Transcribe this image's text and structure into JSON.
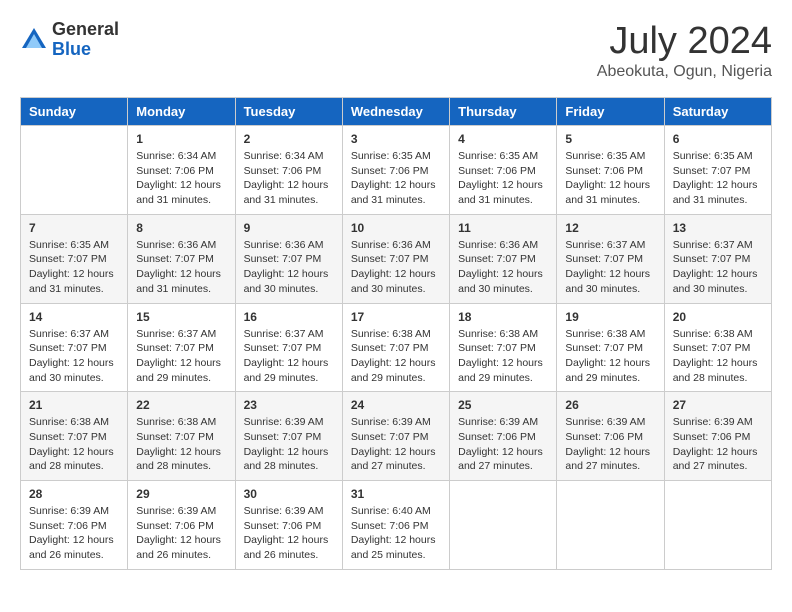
{
  "header": {
    "logo": {
      "general": "General",
      "blue": "Blue"
    },
    "title": "July 2024",
    "location": "Abeokuta, Ogun, Nigeria"
  },
  "days_header": [
    "Sunday",
    "Monday",
    "Tuesday",
    "Wednesday",
    "Thursday",
    "Friday",
    "Saturday"
  ],
  "weeks": [
    [
      {
        "num": "",
        "info": ""
      },
      {
        "num": "1",
        "info": "Sunrise: 6:34 AM\nSunset: 7:06 PM\nDaylight: 12 hours\nand 31 minutes."
      },
      {
        "num": "2",
        "info": "Sunrise: 6:34 AM\nSunset: 7:06 PM\nDaylight: 12 hours\nand 31 minutes."
      },
      {
        "num": "3",
        "info": "Sunrise: 6:35 AM\nSunset: 7:06 PM\nDaylight: 12 hours\nand 31 minutes."
      },
      {
        "num": "4",
        "info": "Sunrise: 6:35 AM\nSunset: 7:06 PM\nDaylight: 12 hours\nand 31 minutes."
      },
      {
        "num": "5",
        "info": "Sunrise: 6:35 AM\nSunset: 7:06 PM\nDaylight: 12 hours\nand 31 minutes."
      },
      {
        "num": "6",
        "info": "Sunrise: 6:35 AM\nSunset: 7:07 PM\nDaylight: 12 hours\nand 31 minutes."
      }
    ],
    [
      {
        "num": "7",
        "info": "Sunrise: 6:35 AM\nSunset: 7:07 PM\nDaylight: 12 hours\nand 31 minutes."
      },
      {
        "num": "8",
        "info": "Sunrise: 6:36 AM\nSunset: 7:07 PM\nDaylight: 12 hours\nand 31 minutes."
      },
      {
        "num": "9",
        "info": "Sunrise: 6:36 AM\nSunset: 7:07 PM\nDaylight: 12 hours\nand 30 minutes."
      },
      {
        "num": "10",
        "info": "Sunrise: 6:36 AM\nSunset: 7:07 PM\nDaylight: 12 hours\nand 30 minutes."
      },
      {
        "num": "11",
        "info": "Sunrise: 6:36 AM\nSunset: 7:07 PM\nDaylight: 12 hours\nand 30 minutes."
      },
      {
        "num": "12",
        "info": "Sunrise: 6:37 AM\nSunset: 7:07 PM\nDaylight: 12 hours\nand 30 minutes."
      },
      {
        "num": "13",
        "info": "Sunrise: 6:37 AM\nSunset: 7:07 PM\nDaylight: 12 hours\nand 30 minutes."
      }
    ],
    [
      {
        "num": "14",
        "info": "Sunrise: 6:37 AM\nSunset: 7:07 PM\nDaylight: 12 hours\nand 30 minutes."
      },
      {
        "num": "15",
        "info": "Sunrise: 6:37 AM\nSunset: 7:07 PM\nDaylight: 12 hours\nand 29 minutes."
      },
      {
        "num": "16",
        "info": "Sunrise: 6:37 AM\nSunset: 7:07 PM\nDaylight: 12 hours\nand 29 minutes."
      },
      {
        "num": "17",
        "info": "Sunrise: 6:38 AM\nSunset: 7:07 PM\nDaylight: 12 hours\nand 29 minutes."
      },
      {
        "num": "18",
        "info": "Sunrise: 6:38 AM\nSunset: 7:07 PM\nDaylight: 12 hours\nand 29 minutes."
      },
      {
        "num": "19",
        "info": "Sunrise: 6:38 AM\nSunset: 7:07 PM\nDaylight: 12 hours\nand 29 minutes."
      },
      {
        "num": "20",
        "info": "Sunrise: 6:38 AM\nSunset: 7:07 PM\nDaylight: 12 hours\nand 28 minutes."
      }
    ],
    [
      {
        "num": "21",
        "info": "Sunrise: 6:38 AM\nSunset: 7:07 PM\nDaylight: 12 hours\nand 28 minutes."
      },
      {
        "num": "22",
        "info": "Sunrise: 6:38 AM\nSunset: 7:07 PM\nDaylight: 12 hours\nand 28 minutes."
      },
      {
        "num": "23",
        "info": "Sunrise: 6:39 AM\nSunset: 7:07 PM\nDaylight: 12 hours\nand 28 minutes."
      },
      {
        "num": "24",
        "info": "Sunrise: 6:39 AM\nSunset: 7:07 PM\nDaylight: 12 hours\nand 27 minutes."
      },
      {
        "num": "25",
        "info": "Sunrise: 6:39 AM\nSunset: 7:06 PM\nDaylight: 12 hours\nand 27 minutes."
      },
      {
        "num": "26",
        "info": "Sunrise: 6:39 AM\nSunset: 7:06 PM\nDaylight: 12 hours\nand 27 minutes."
      },
      {
        "num": "27",
        "info": "Sunrise: 6:39 AM\nSunset: 7:06 PM\nDaylight: 12 hours\nand 27 minutes."
      }
    ],
    [
      {
        "num": "28",
        "info": "Sunrise: 6:39 AM\nSunset: 7:06 PM\nDaylight: 12 hours\nand 26 minutes."
      },
      {
        "num": "29",
        "info": "Sunrise: 6:39 AM\nSunset: 7:06 PM\nDaylight: 12 hours\nand 26 minutes."
      },
      {
        "num": "30",
        "info": "Sunrise: 6:39 AM\nSunset: 7:06 PM\nDaylight: 12 hours\nand 26 minutes."
      },
      {
        "num": "31",
        "info": "Sunrise: 6:40 AM\nSunset: 7:06 PM\nDaylight: 12 hours\nand 25 minutes."
      },
      {
        "num": "",
        "info": ""
      },
      {
        "num": "",
        "info": ""
      },
      {
        "num": "",
        "info": ""
      }
    ]
  ]
}
